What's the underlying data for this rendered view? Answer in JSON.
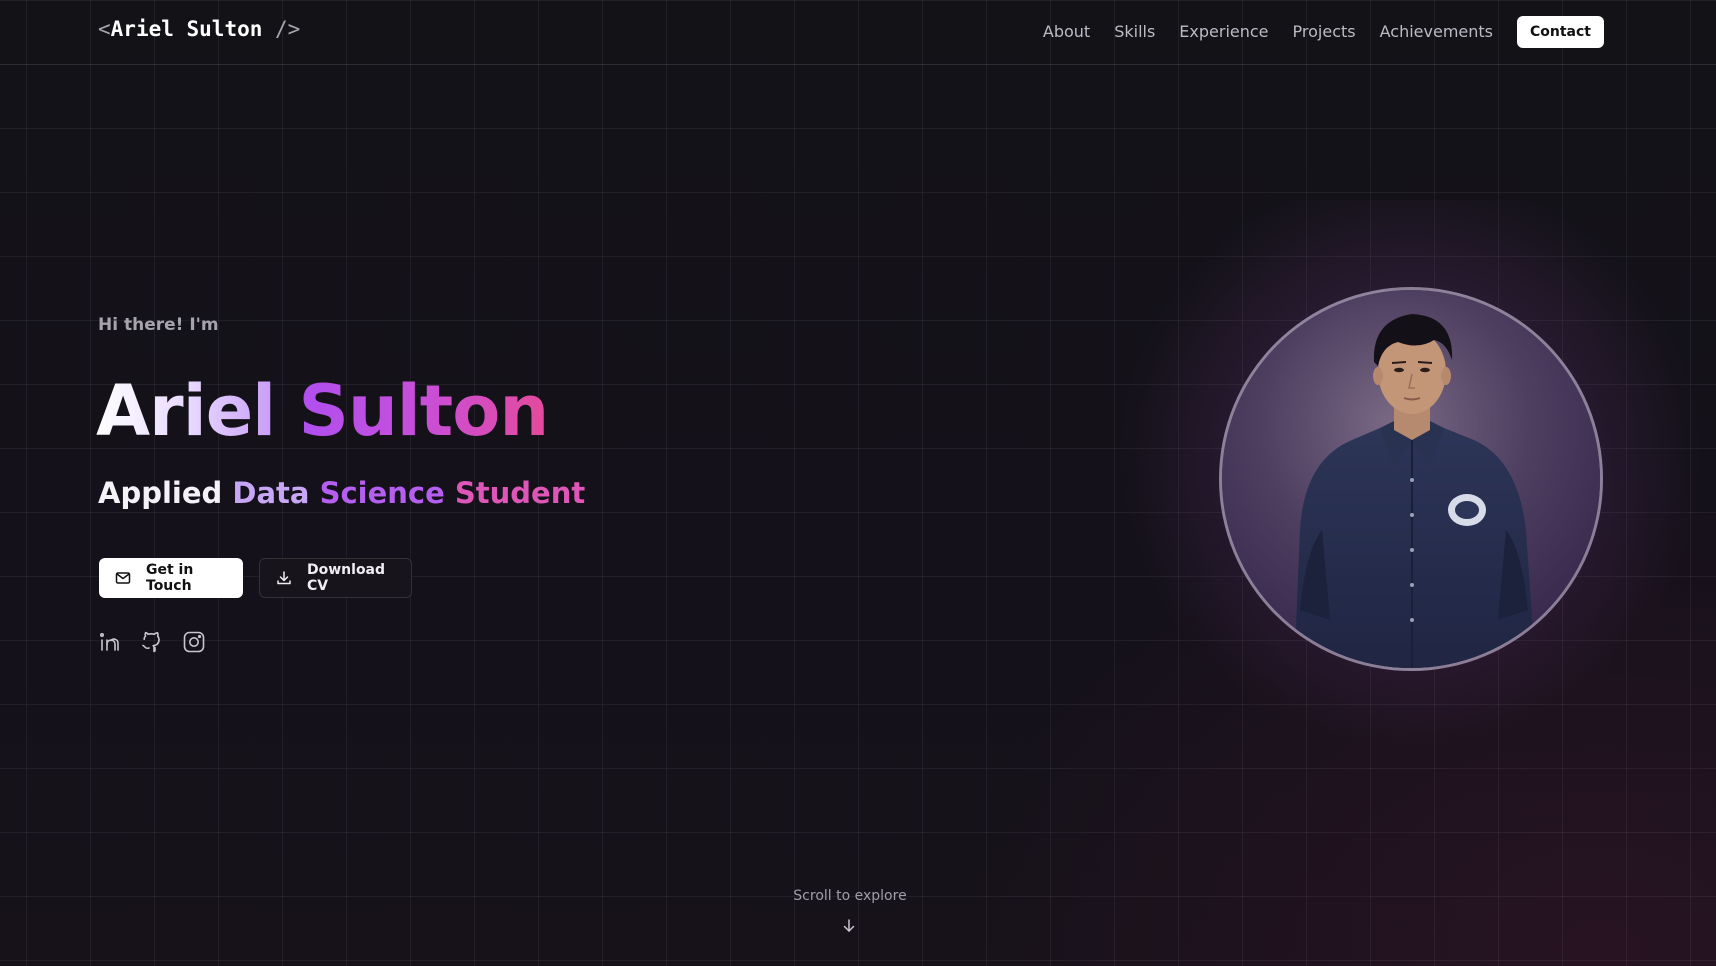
{
  "nav": {
    "logo_open": "<",
    "logo_name": "Ariel Sulton",
    "logo_close": " />",
    "links": [
      {
        "label": "About"
      },
      {
        "label": "Skills"
      },
      {
        "label": "Experience"
      },
      {
        "label": "Projects"
      },
      {
        "label": "Achievements"
      }
    ],
    "contact_label": "Contact"
  },
  "hero": {
    "greeting": "Hi there! I'm",
    "first_name": "Ariel",
    "last_name": "Sulton",
    "role_words": [
      "Applied",
      "Data",
      "Science",
      "Student"
    ],
    "primary_button": {
      "label": "Get in Touch",
      "icon": "mail-icon"
    },
    "secondary_button": {
      "label": "Download CV",
      "icon": "download-icon"
    },
    "socials": [
      {
        "icon": "linkedin-icon"
      },
      {
        "icon": "github-icon"
      },
      {
        "icon": "instagram-icon"
      }
    ]
  },
  "scroll_hint": {
    "label": "Scroll to explore",
    "icon": "arrow-down-icon"
  },
  "colors": {
    "background": "#131117",
    "accent_purple": "#b04ff0",
    "accent_pink": "#e54a9c"
  }
}
